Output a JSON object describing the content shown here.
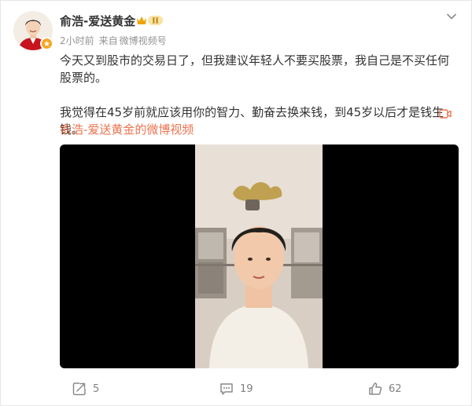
{
  "post": {
    "author": "俞浩-爱送黄金",
    "vip_level": "II",
    "time": "2小时前",
    "source_prefix": "来自",
    "source": "微博视频号",
    "paragraph1": "今天又到股市的交易日了，但我建议年轻人不要买股票，我自己是不买任何股票的。",
    "paragraph2": "我觉得在45岁前就应该用你的智力、勤奋去换来钱，到45岁以后才是钱生钱。",
    "video_link": "俞浩-爱送黄金的微博视频",
    "icons": {
      "avatar": "avatar-photo",
      "verified": "verified-badge-icon",
      "vip": "vip-badge-icon",
      "more": "chevron-down-icon",
      "video_link": "video-icon",
      "forward": "forward-icon",
      "comment": "comment-icon",
      "like": "like-icon"
    }
  },
  "actions": {
    "forward_count": "5",
    "comment_count": "19",
    "like_count": "62"
  },
  "colors": {
    "link": "#eb7350",
    "meta": "#939393",
    "text": "#333333",
    "verified": "#f5a623"
  }
}
